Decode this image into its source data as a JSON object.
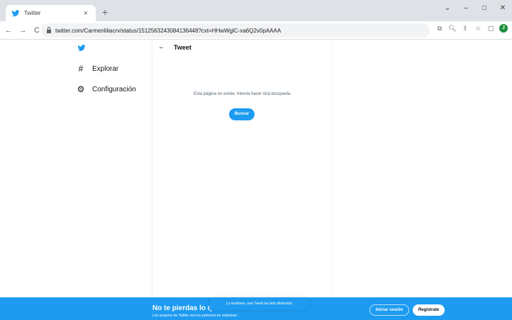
{
  "browser": {
    "tab_title": "Twitter",
    "tab_close": "×",
    "new_tab": "+",
    "url": "twitter.com/Carmenliliacrv/status/1512563243084136448?cxt=HHwWglC-xa6Q2v0pAAAA",
    "profile_initial": "J",
    "window_controls": [
      "⌄",
      "–",
      "□",
      "✕"
    ]
  },
  "nav": {
    "back": "←",
    "forward": "→",
    "reload": "C"
  },
  "extensions": [
    "⧉",
    "🔍︎",
    "⇪",
    "☆",
    "▢"
  ],
  "sidebar": {
    "items": [
      {
        "icon": "#",
        "label": "Explorar"
      },
      {
        "icon": "⚙",
        "label": "Configuración"
      }
    ]
  },
  "main": {
    "back_arrow": "←",
    "title": "Tweet",
    "empty_message": "Esta página no existe. Intenta hacer otra búsqueda.",
    "search_button": "Buscar"
  },
  "banner": {
    "title": "No te pierdas lo qu",
    "subtitle": "Los usuarios de Twitter son los primeros en enterarse.",
    "toast": "Lo sentimos, ese Tweet ha sido eliminado.",
    "login": "Iniciar sesión",
    "register": "Regístrate"
  },
  "colors": {
    "brand": "#1d9bf0",
    "chrome_bg": "#dee1e6",
    "text_secondary": "#536471"
  }
}
